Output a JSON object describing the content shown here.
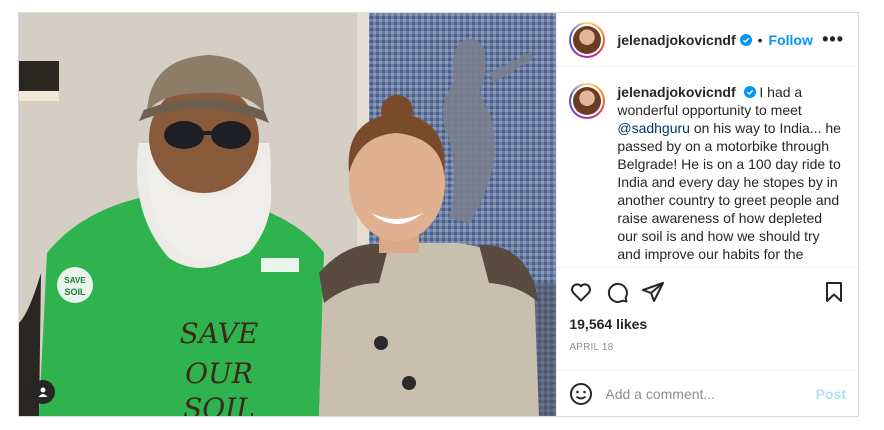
{
  "header": {
    "username": "jelenadjokovicndf",
    "separator": "•",
    "follow_label": "Follow",
    "more_label": "•••"
  },
  "caption": {
    "username": "jelenadjokovicndf",
    "text_before": "I had a wonderful opportunity to meet ",
    "mention": "@sadhguru",
    "text_after": " on his way to India... he passed by on a motorbike through Belgrade! He is on a 100 day ride to India and every day he stopes by in another country to greet people and raise awareness of how depleted our soil is and how we should try and improve our habits for the benefit of our health, our children and our planet! His mission is called"
  },
  "photo": {
    "shirt_badge_line1": "SAVE",
    "shirt_badge_line2": "SOIL",
    "shirt_text_line1": "SAVE",
    "shirt_text_line2": "OUR",
    "shirt_text_line3": "SOIL"
  },
  "stats": {
    "likes": "19,564 likes",
    "date": "APRIL 18"
  },
  "comment": {
    "placeholder": "Add a comment...",
    "post_label": "Post"
  },
  "colors": {
    "accent": "#0095f6",
    "post_disabled": "#b2dffc",
    "muted": "#8e8e8e",
    "mention": "#00376b"
  },
  "icons": [
    "verified-icon",
    "heart-icon",
    "comment-icon",
    "share-icon",
    "bookmark-icon",
    "emoji-icon",
    "user-tag-icon",
    "more-icon"
  ]
}
